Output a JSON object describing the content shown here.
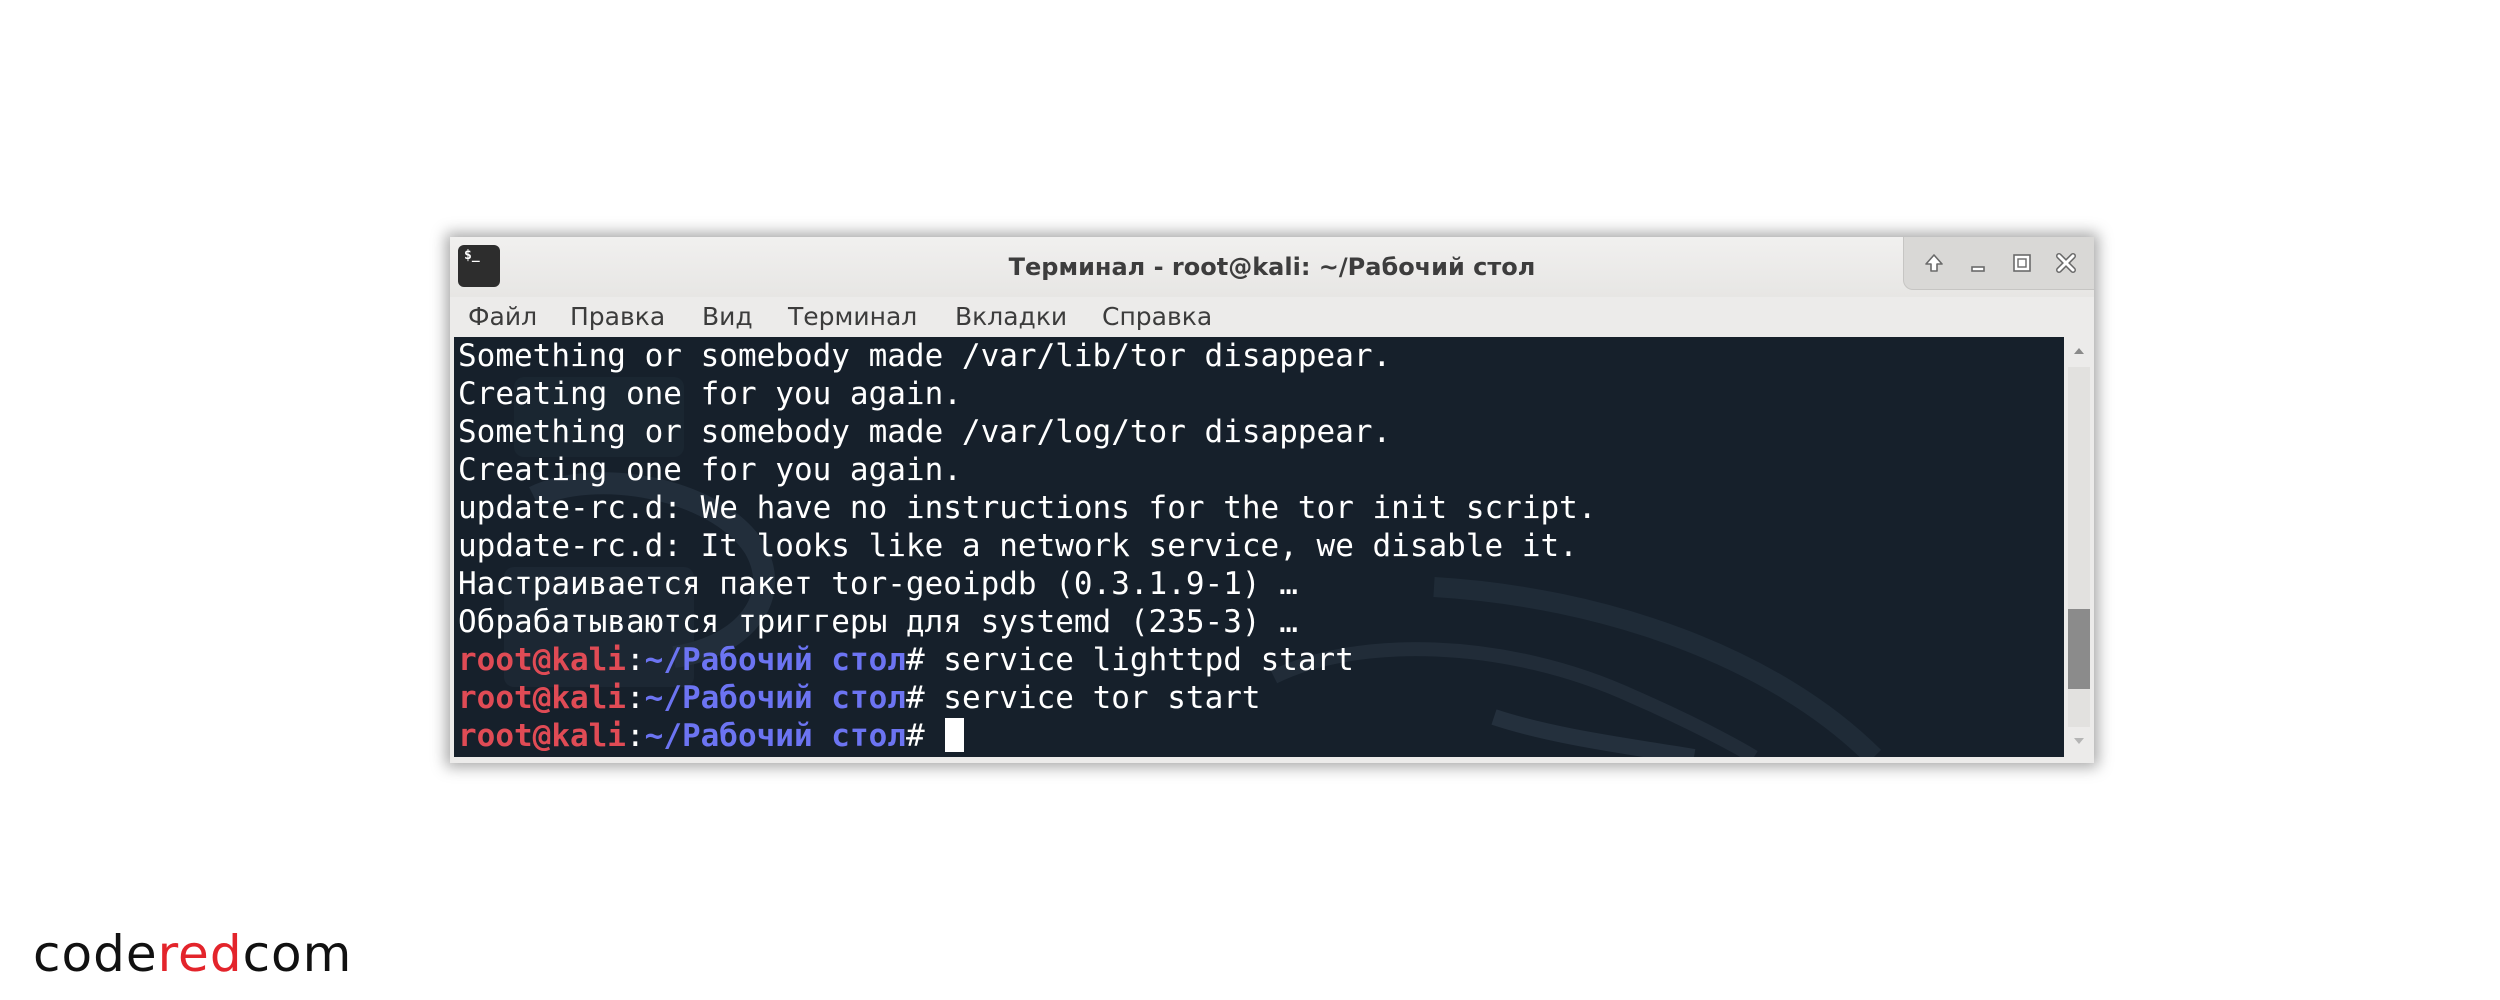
{
  "window": {
    "title": "Терминал - root@kali: ~/Рабочий стол",
    "app_icon_label": "$_"
  },
  "menu": [
    "Файл",
    "Правка",
    "Вид",
    "Терминал",
    "Вкладки",
    "Справка"
  ],
  "terminal": {
    "output": [
      "Something or somebody made /var/lib/tor disappear.",
      "Creating one for you again.",
      "Something or somebody made /var/log/tor disappear.",
      "Creating one for you again.",
      "update-rc.d: We have no instructions for the tor init script.",
      "update-rc.d: It looks like a network service, we disable it.",
      "Настраивается пакет tor-geoipdb (0.3.1.9-1) …",
      "Обрабатываются триггеры для systemd (235-3) …"
    ],
    "prompts": [
      {
        "user": "root@kali",
        "sep": ":",
        "path": "~/Рабочий стол",
        "hash": "#",
        "command": " service lighttpd start"
      },
      {
        "user": "root@kali",
        "sep": ":",
        "path": "~/Рабочий стол",
        "hash": "#",
        "command": " service tor start"
      },
      {
        "user": "root@kali",
        "sep": ":",
        "path": "~/Рабочий стол",
        "hash": "#",
        "command": " "
      }
    ]
  },
  "brand": {
    "part1": "code",
    "part2": "red",
    "part3": "com"
  },
  "colors": {
    "terminal_bg": "#16202b",
    "prompt_user": "#e04b55",
    "prompt_path": "#6c74f2",
    "brand_accent": "#e3242b"
  }
}
